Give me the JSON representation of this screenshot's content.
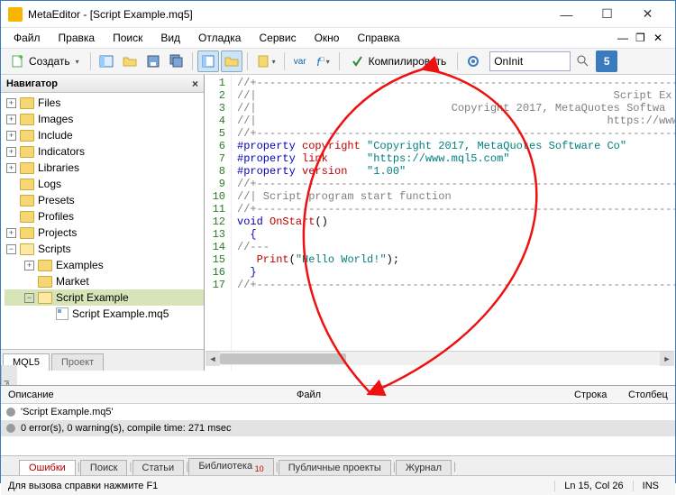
{
  "window": {
    "title": "MetaEditor - [Script Example.mq5]"
  },
  "menu": {
    "items": [
      "Файл",
      "Правка",
      "Поиск",
      "Вид",
      "Отладка",
      "Сервис",
      "Окно",
      "Справка"
    ]
  },
  "toolbar": {
    "create_label": "Создать",
    "compile_label": "Компилировать",
    "search_value": "OnInit"
  },
  "nav": {
    "title": "Навигатор",
    "items": [
      {
        "depth": 1,
        "exp": "+",
        "label": "Files",
        "ico": "folder"
      },
      {
        "depth": 1,
        "exp": "+",
        "label": "Images",
        "ico": "folder"
      },
      {
        "depth": 1,
        "exp": "+",
        "label": "Include",
        "ico": "folder"
      },
      {
        "depth": 1,
        "exp": "+",
        "label": "Indicators",
        "ico": "folder"
      },
      {
        "depth": 1,
        "exp": "+",
        "label": "Libraries",
        "ico": "folder"
      },
      {
        "depth": 1,
        "exp": "",
        "label": "Logs",
        "ico": "folder"
      },
      {
        "depth": 1,
        "exp": "",
        "label": "Presets",
        "ico": "folder"
      },
      {
        "depth": 1,
        "exp": "",
        "label": "Profiles",
        "ico": "folder"
      },
      {
        "depth": 1,
        "exp": "+",
        "label": "Projects",
        "ico": "folder"
      },
      {
        "depth": 1,
        "exp": "−",
        "label": "Scripts",
        "ico": "folder-open"
      },
      {
        "depth": 2,
        "exp": "+",
        "label": "Examples",
        "ico": "folder"
      },
      {
        "depth": 2,
        "exp": "",
        "label": "Market",
        "ico": "folder"
      },
      {
        "depth": 2,
        "exp": "−",
        "label": "Script Example",
        "ico": "folder-open",
        "sel": true
      },
      {
        "depth": 3,
        "exp": "",
        "label": "Script Example.mq5",
        "ico": "file"
      }
    ],
    "tabs": [
      "MQL5",
      "Проект"
    ]
  },
  "code": {
    "lines": [
      {
        "n": 1,
        "html": "<span class='c-cmt'>//+------------------------------------------------------------------+</span>"
      },
      {
        "n": 2,
        "html": "<span class='c-cmt'>//|                                                       Script Ex</span>"
      },
      {
        "n": 3,
        "html": "<span class='c-cmt'>//|                              Copyright 2017, MetaQuotes Softwa</span>"
      },
      {
        "n": 4,
        "html": "<span class='c-cmt'>//|                                                      https://www</span>"
      },
      {
        "n": 5,
        "html": "<span class='c-cmt'>//+------------------------------------------------------------------+</span>"
      },
      {
        "n": 6,
        "html": "<span class='c-pp'>#property</span> <span class='c-ppkey'>copyright</span> <span class='c-str'>\"Copyright 2017, MetaQuotes Software Co\"</span>"
      },
      {
        "n": 7,
        "html": "<span class='c-pp'>#property</span> <span class='c-ppkey'>link</span>      <span class='c-str'>\"https://www.mql5.com\"</span>"
      },
      {
        "n": 8,
        "html": "<span class='c-pp'>#property</span> <span class='c-ppkey'>version</span>   <span class='c-str'>\"1.00\"</span>"
      },
      {
        "n": 9,
        "html": "<span class='c-cmt'>//+------------------------------------------------------------------+</span>"
      },
      {
        "n": 10,
        "html": "<span class='c-cmt'>//| Script program start function</span>"
      },
      {
        "n": 11,
        "html": "<span class='c-cmt'>//+------------------------------------------------------------------+</span>"
      },
      {
        "n": 12,
        "html": "<span class='c-kw'>void</span> <span class='c-fn'>OnStart</span>()"
      },
      {
        "n": 13,
        "html": "  <span class='c-kw'>{</span>"
      },
      {
        "n": 14,
        "html": "<span class='c-cmt'>//---</span>"
      },
      {
        "n": 15,
        "html": "   <span class='c-fn'>Print</span>(<span class='c-str'>\"Hello World!\"</span>);"
      },
      {
        "n": 16,
        "html": "  <span class='c-kw'>}</span>"
      },
      {
        "n": 17,
        "html": "<span class='c-cmt'>//+------------------------------------------------------------------+</span>"
      }
    ]
  },
  "output": {
    "side_label": "Инструменты",
    "headers": {
      "desc": "Описание",
      "file": "Файл",
      "line": "Строка",
      "col": "Столбец"
    },
    "rows": [
      {
        "text": "'Script Example.mq5'",
        "sel": false
      },
      {
        "text": "0 error(s), 0 warning(s), compile time: 271 msec",
        "sel": true
      }
    ],
    "tabs": [
      {
        "label": "Ошибки",
        "active": true
      },
      {
        "label": "Поиск"
      },
      {
        "label": "Статьи"
      },
      {
        "label": "Библиотека",
        "badge": "10"
      },
      {
        "label": "Публичные проекты"
      },
      {
        "label": "Журнал"
      }
    ]
  },
  "status": {
    "hint": "Для вызова справки нажмите F1",
    "pos": "Ln 15, Col 26",
    "mode": "INS"
  }
}
